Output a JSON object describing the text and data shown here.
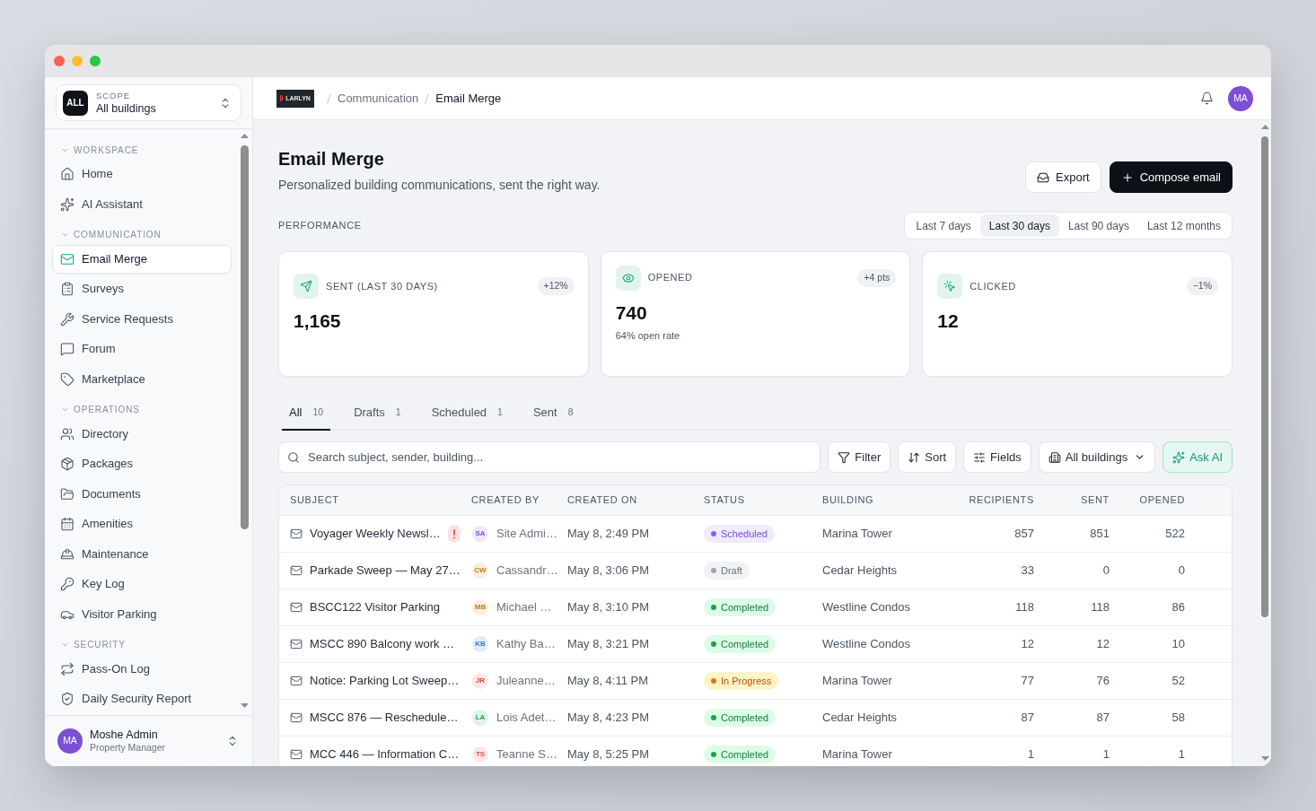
{
  "sidebar": {
    "scope": {
      "badge": "ALL",
      "label": "SCOPE",
      "value": "All buildings"
    },
    "sections": [
      {
        "title": "WORKSPACE",
        "expanded": true,
        "items": [
          {
            "label": "Home",
            "selected": false
          },
          {
            "label": "AI Assistant",
            "selected": false
          }
        ]
      },
      {
        "title": "COMMUNICATION",
        "expanded": true,
        "items": [
          {
            "label": "Email Merge",
            "selected": true
          },
          {
            "label": "Surveys",
            "selected": false
          },
          {
            "label": "Service Requests",
            "selected": false
          },
          {
            "label": "Forum",
            "selected": false
          },
          {
            "label": "Marketplace",
            "selected": false
          }
        ]
      },
      {
        "title": "OPERATIONS",
        "expanded": true,
        "items": [
          {
            "label": "Directory",
            "selected": false
          },
          {
            "label": "Packages",
            "selected": false
          },
          {
            "label": "Documents",
            "selected": false
          },
          {
            "label": "Amenities",
            "selected": false
          },
          {
            "label": "Maintenance",
            "selected": false
          },
          {
            "label": "Key Log",
            "selected": false
          },
          {
            "label": "Visitor Parking",
            "selected": false
          }
        ]
      },
      {
        "title": "SECURITY",
        "expanded": true,
        "items": [
          {
            "label": "Pass-On Log",
            "selected": false
          },
          {
            "label": "Daily Security Report",
            "selected": false
          }
        ]
      }
    ],
    "user": {
      "initials": "MA",
      "name": "Moshe Admin",
      "role": "Property Manager"
    }
  },
  "header": {
    "logo": "LARLYN",
    "breadcrumb": [
      "Communication",
      "Email Merge"
    ],
    "avatar": "MA"
  },
  "page": {
    "title": "Email Merge",
    "subtitle": "Personalized building communications, sent the right way.",
    "actions": [
      {
        "label": "Export",
        "kind": "secondary"
      },
      {
        "label": "Compose email",
        "kind": "primary"
      }
    ]
  },
  "performance": {
    "label": "PERFORMANCE",
    "ranges": [
      {
        "label": "Last 7 days",
        "selected": false
      },
      {
        "label": "Last 30 days",
        "selected": true
      },
      {
        "label": "Last 90 days",
        "selected": false
      },
      {
        "label": "Last 12 months",
        "selected": false
      }
    ],
    "cards": [
      {
        "label": "SENT (LAST 30 DAYS)",
        "value": "1,165",
        "delta": "+12%"
      },
      {
        "label": "OPENED",
        "value": "740",
        "delta": "+4 pts",
        "note": "64% open rate"
      },
      {
        "label": "CLICKED",
        "value": "12",
        "delta": "−1%"
      }
    ]
  },
  "tabs": [
    {
      "label": "All",
      "count": "10",
      "selected": true
    },
    {
      "label": "Drafts",
      "count": "1",
      "selected": false
    },
    {
      "label": "Scheduled",
      "count": "1",
      "selected": false
    },
    {
      "label": "Sent",
      "count": "8",
      "selected": false
    }
  ],
  "toolbar": {
    "search": {
      "placeholder": "Search subject, sender, building..."
    },
    "buttons": [
      {
        "label": "Filter",
        "kind": "plain"
      },
      {
        "label": "Sort",
        "kind": "plain"
      },
      {
        "label": "Fields",
        "kind": "plain"
      },
      {
        "label": "All buildings",
        "kind": "dropdown"
      },
      {
        "label": "Ask AI",
        "kind": "ai"
      }
    ]
  },
  "table": {
    "columns": [
      "SUBJECT",
      "CREATED BY",
      "CREATED ON",
      "STATUS",
      "BUILDING",
      "RECIPIENTS",
      "SENT",
      "OPENED"
    ],
    "rows": [
      {
        "subject": "Voyager Weekly Newsl…",
        "flagged": true,
        "creator": {
          "initials": "SA",
          "name": "Site Admi…",
          "color": "#7c4ddb"
        },
        "created_on": "May 8, 2:49 PM",
        "status": {
          "label": "Scheduled",
          "kind": "scheduled"
        },
        "building": "Marina Tower",
        "recipients": "857",
        "sent": "851",
        "opened": "522"
      },
      {
        "subject": "Parkade Sweep — May 27…",
        "flagged": false,
        "creator": {
          "initials": "CW",
          "name": "Cassandr…",
          "color": "#c27c0e"
        },
        "created_on": "May 8, 3:06 PM",
        "status": {
          "label": "Draft",
          "kind": "draft"
        },
        "building": "Cedar Heights",
        "recipients": "33",
        "sent": "0",
        "opened": "0"
      },
      {
        "subject": "BSCC122 Visitor Parking",
        "flagged": false,
        "creator": {
          "initials": "MB",
          "name": "Michael …",
          "color": "#c27c0e"
        },
        "created_on": "May 8, 3:10 PM",
        "status": {
          "label": "Completed",
          "kind": "completed"
        },
        "building": "Westline Condos",
        "recipients": "118",
        "sent": "118",
        "opened": "86"
      },
      {
        "subject": "MSCC 890 Balcony work …",
        "flagged": false,
        "creator": {
          "initials": "KB",
          "name": "Kathy Ba…",
          "color": "#2f7ad8"
        },
        "created_on": "May 8, 3:21 PM",
        "status": {
          "label": "Completed",
          "kind": "completed"
        },
        "building": "Westline Condos",
        "recipients": "12",
        "sent": "12",
        "opened": "10"
      },
      {
        "subject": "Notice: Parking Lot Sweep…",
        "flagged": false,
        "creator": {
          "initials": "JR",
          "name": "Juleanne…",
          "color": "#e5484d"
        },
        "created_on": "May 8, 4:11 PM",
        "status": {
          "label": "In Progress",
          "kind": "in_progress"
        },
        "building": "Marina Tower",
        "recipients": "77",
        "sent": "76",
        "opened": "52"
      },
      {
        "subject": "MSCC 876 — Reschedule…",
        "flagged": false,
        "creator": {
          "initials": "LA",
          "name": "Lois Adet…",
          "color": "#16a34a"
        },
        "created_on": "May 8, 4:23 PM",
        "status": {
          "label": "Completed",
          "kind": "completed"
        },
        "building": "Cedar Heights",
        "recipients": "87",
        "sent": "87",
        "opened": "58"
      },
      {
        "subject": "MCC 446 — Information C…",
        "flagged": false,
        "creator": {
          "initials": "TS",
          "name": "Teanne S…",
          "color": "#e5484d"
        },
        "created_on": "May 8, 5:25 PM",
        "status": {
          "label": "Completed",
          "kind": "completed"
        },
        "building": "Marina Tower",
        "recipients": "1",
        "sent": "1",
        "opened": "1"
      }
    ]
  }
}
